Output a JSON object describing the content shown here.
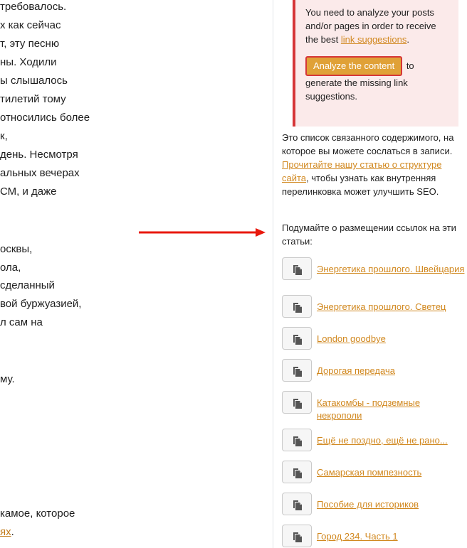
{
  "editor": {
    "lines": [
      "требовалось.",
      "х как сейчас",
      "т, эту песню",
      "ны. Ходили",
      "ы слышалось",
      "тилетий тому",
      "относились более",
      "к,",
      " день. Несмотря",
      "альных вечерах",
      "СМ, и даже",
      "осквы,",
      "ола,",
      "сделанный",
      "вой буржуазией,",
      "л сам на",
      "му.",
      "камое, которое"
    ],
    "last_link": "ях",
    "last_tail": "."
  },
  "notice": {
    "text_before": "You need to analyze your posts and/or pages in order to receive the best ",
    "link": "link suggestions",
    "text_after": ".",
    "button_label": "Analyze the content",
    "button_tail": " to generate the missing link suggestions."
  },
  "description": {
    "text_before": "Это список связанного содержимого, на которое вы можете сослаться в записи. ",
    "link": "Прочитайте нашу статью о структуре сайта",
    "text_after": ", чтобы узнать как внутренняя перелинковка может улучшить SEO."
  },
  "think_text": "Подумайте о размещении ссылок на эти статьи:",
  "suggestions": [
    {
      "title": "Энергетика прошлого. Швейцария"
    },
    {
      "title": "Энергетика прошлого. Светец"
    },
    {
      "title": "London goodbye"
    },
    {
      "title": "Дорогая передача"
    },
    {
      "title": "Катакомбы - подземные некрополи"
    },
    {
      "title": "Ещё не поздно, ещё не рано..."
    },
    {
      "title": "Самарская помпезность"
    },
    {
      "title": "Пособие для историков"
    },
    {
      "title": "Город 234. Часть 1"
    }
  ],
  "icons": {
    "copy": "copy-icon",
    "arrow": "arrow-right-icon"
  },
  "colors": {
    "link": "#d1881f",
    "notice_bg": "#fbeaea",
    "notice_border": "#d63638",
    "button": "#e0a137",
    "arrow": "#e8180c"
  }
}
